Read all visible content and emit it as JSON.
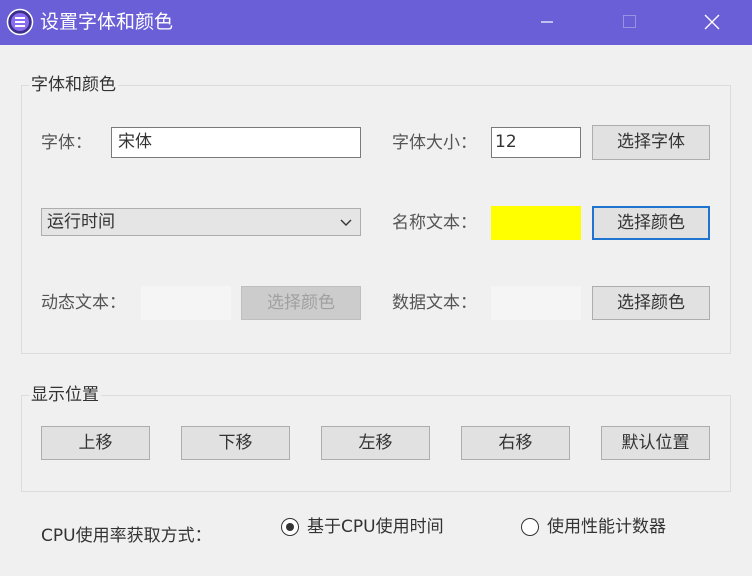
{
  "window": {
    "title": "设置字体和颜色",
    "title_bar_color": "#6a5fd6"
  },
  "font_color_group": {
    "title": "字体和颜色",
    "font_label": "字体：",
    "font_value": "宋体",
    "font_size_label": "字体大小：",
    "font_size_value": "12",
    "choose_font_button": "选择字体",
    "item_select_value": "运行时间",
    "name_text_label": "名称文本：",
    "name_text_color": "#ffff00",
    "name_choose_color_button": "选择颜色",
    "dynamic_text_label": "动态文本：",
    "dynamic_text_color": "#f5f5f5",
    "dynamic_choose_color_button": "选择颜色",
    "data_text_label": "数据文本：",
    "data_text_color": "#f5f5f5",
    "data_choose_color_button": "选择颜色"
  },
  "position_group": {
    "title": "显示位置",
    "move_up": "上移",
    "move_down": "下移",
    "move_left": "左移",
    "move_right": "右移",
    "default_position": "默认位置"
  },
  "cpu_usage": {
    "label": "CPU使用率获取方式：",
    "options": [
      {
        "label": "基于CPU使用时间",
        "selected": true
      },
      {
        "label": "使用性能计数器",
        "selected": false
      }
    ]
  }
}
